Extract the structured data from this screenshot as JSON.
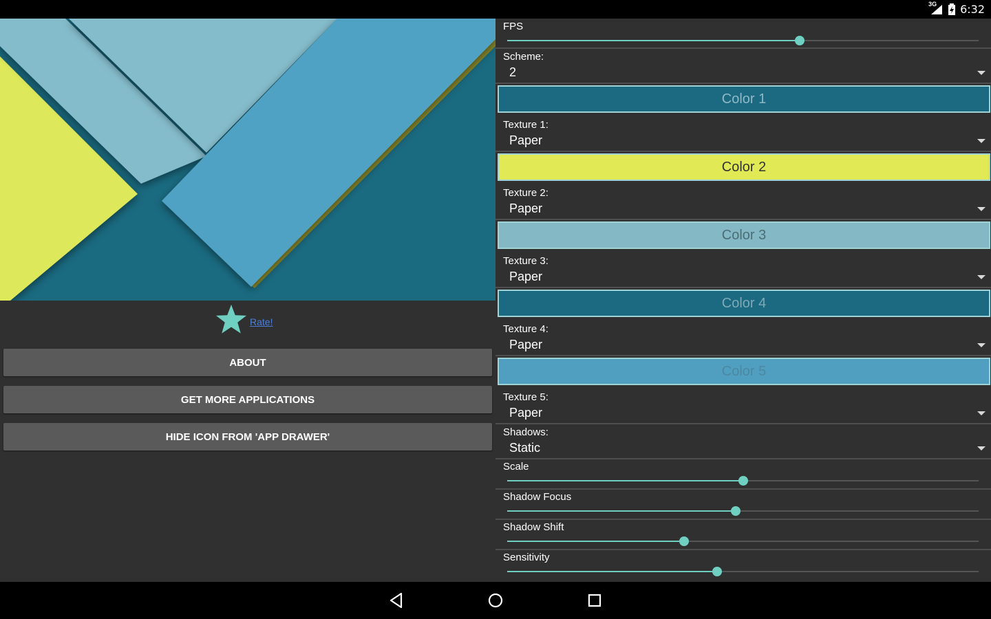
{
  "status_bar": {
    "network": "3G",
    "time": "6:32",
    "icons": [
      "signal-icon",
      "battery-icon"
    ]
  },
  "preview": {
    "colors": {
      "background": "#1a6a80",
      "yellow": "#dde85a",
      "light_blue": "#85bccb",
      "mid_blue": "#4fa2c4",
      "dark_teal": "#1a6a80",
      "olive": "#8a8a2c"
    }
  },
  "rate": {
    "icon": "star-icon",
    "label": "Rate!",
    "star_color": "#6fcfc0"
  },
  "buttons": {
    "about": "ABOUT",
    "more_apps": "GET MORE APPLICATIONS",
    "hide_icon": "HIDE ICON FROM 'APP DRAWER'"
  },
  "settings": {
    "fps": {
      "label": "FPS",
      "value": 0.62
    },
    "scheme": {
      "label": "Scheme:",
      "value": "2"
    },
    "color1": {
      "label": "Color 1",
      "bg": "#1b6a82",
      "text_color": "#8fb9c6"
    },
    "texture1": {
      "label": "Texture 1:",
      "value": "Paper"
    },
    "color2": {
      "label": "Color 2",
      "bg": "#e1ea55",
      "text_color": "#333333"
    },
    "texture2": {
      "label": "Texture 2:",
      "value": "Paper"
    },
    "color3": {
      "label": "Color 3",
      "bg": "#84b8c4",
      "text_color": "#4a6e76"
    },
    "texture3": {
      "label": "Texture 3:",
      "value": "Paper"
    },
    "color4": {
      "label": "Color 4",
      "bg": "#1b6a82",
      "text_color": "#7fa9b6"
    },
    "texture4": {
      "label": "Texture 4:",
      "value": "Paper"
    },
    "color5": {
      "label": "Color 5",
      "bg": "#519fc0",
      "text_color": "#4a88a2"
    },
    "texture5": {
      "label": "Texture 5:",
      "value": "Paper"
    },
    "shadows": {
      "label": "Shadows:",
      "value": "Static"
    },
    "scale": {
      "label": "Scale",
      "value": 0.5
    },
    "shadow_focus": {
      "label": "Shadow Focus",
      "value": 0.485
    },
    "shadow_shift": {
      "label": "Shadow Shift",
      "value": 0.375
    },
    "sensitivity": {
      "label": "Sensitivity",
      "value": 0.445
    }
  },
  "nav_bar": {
    "icons": [
      "back-icon",
      "home-icon",
      "recents-icon"
    ]
  }
}
